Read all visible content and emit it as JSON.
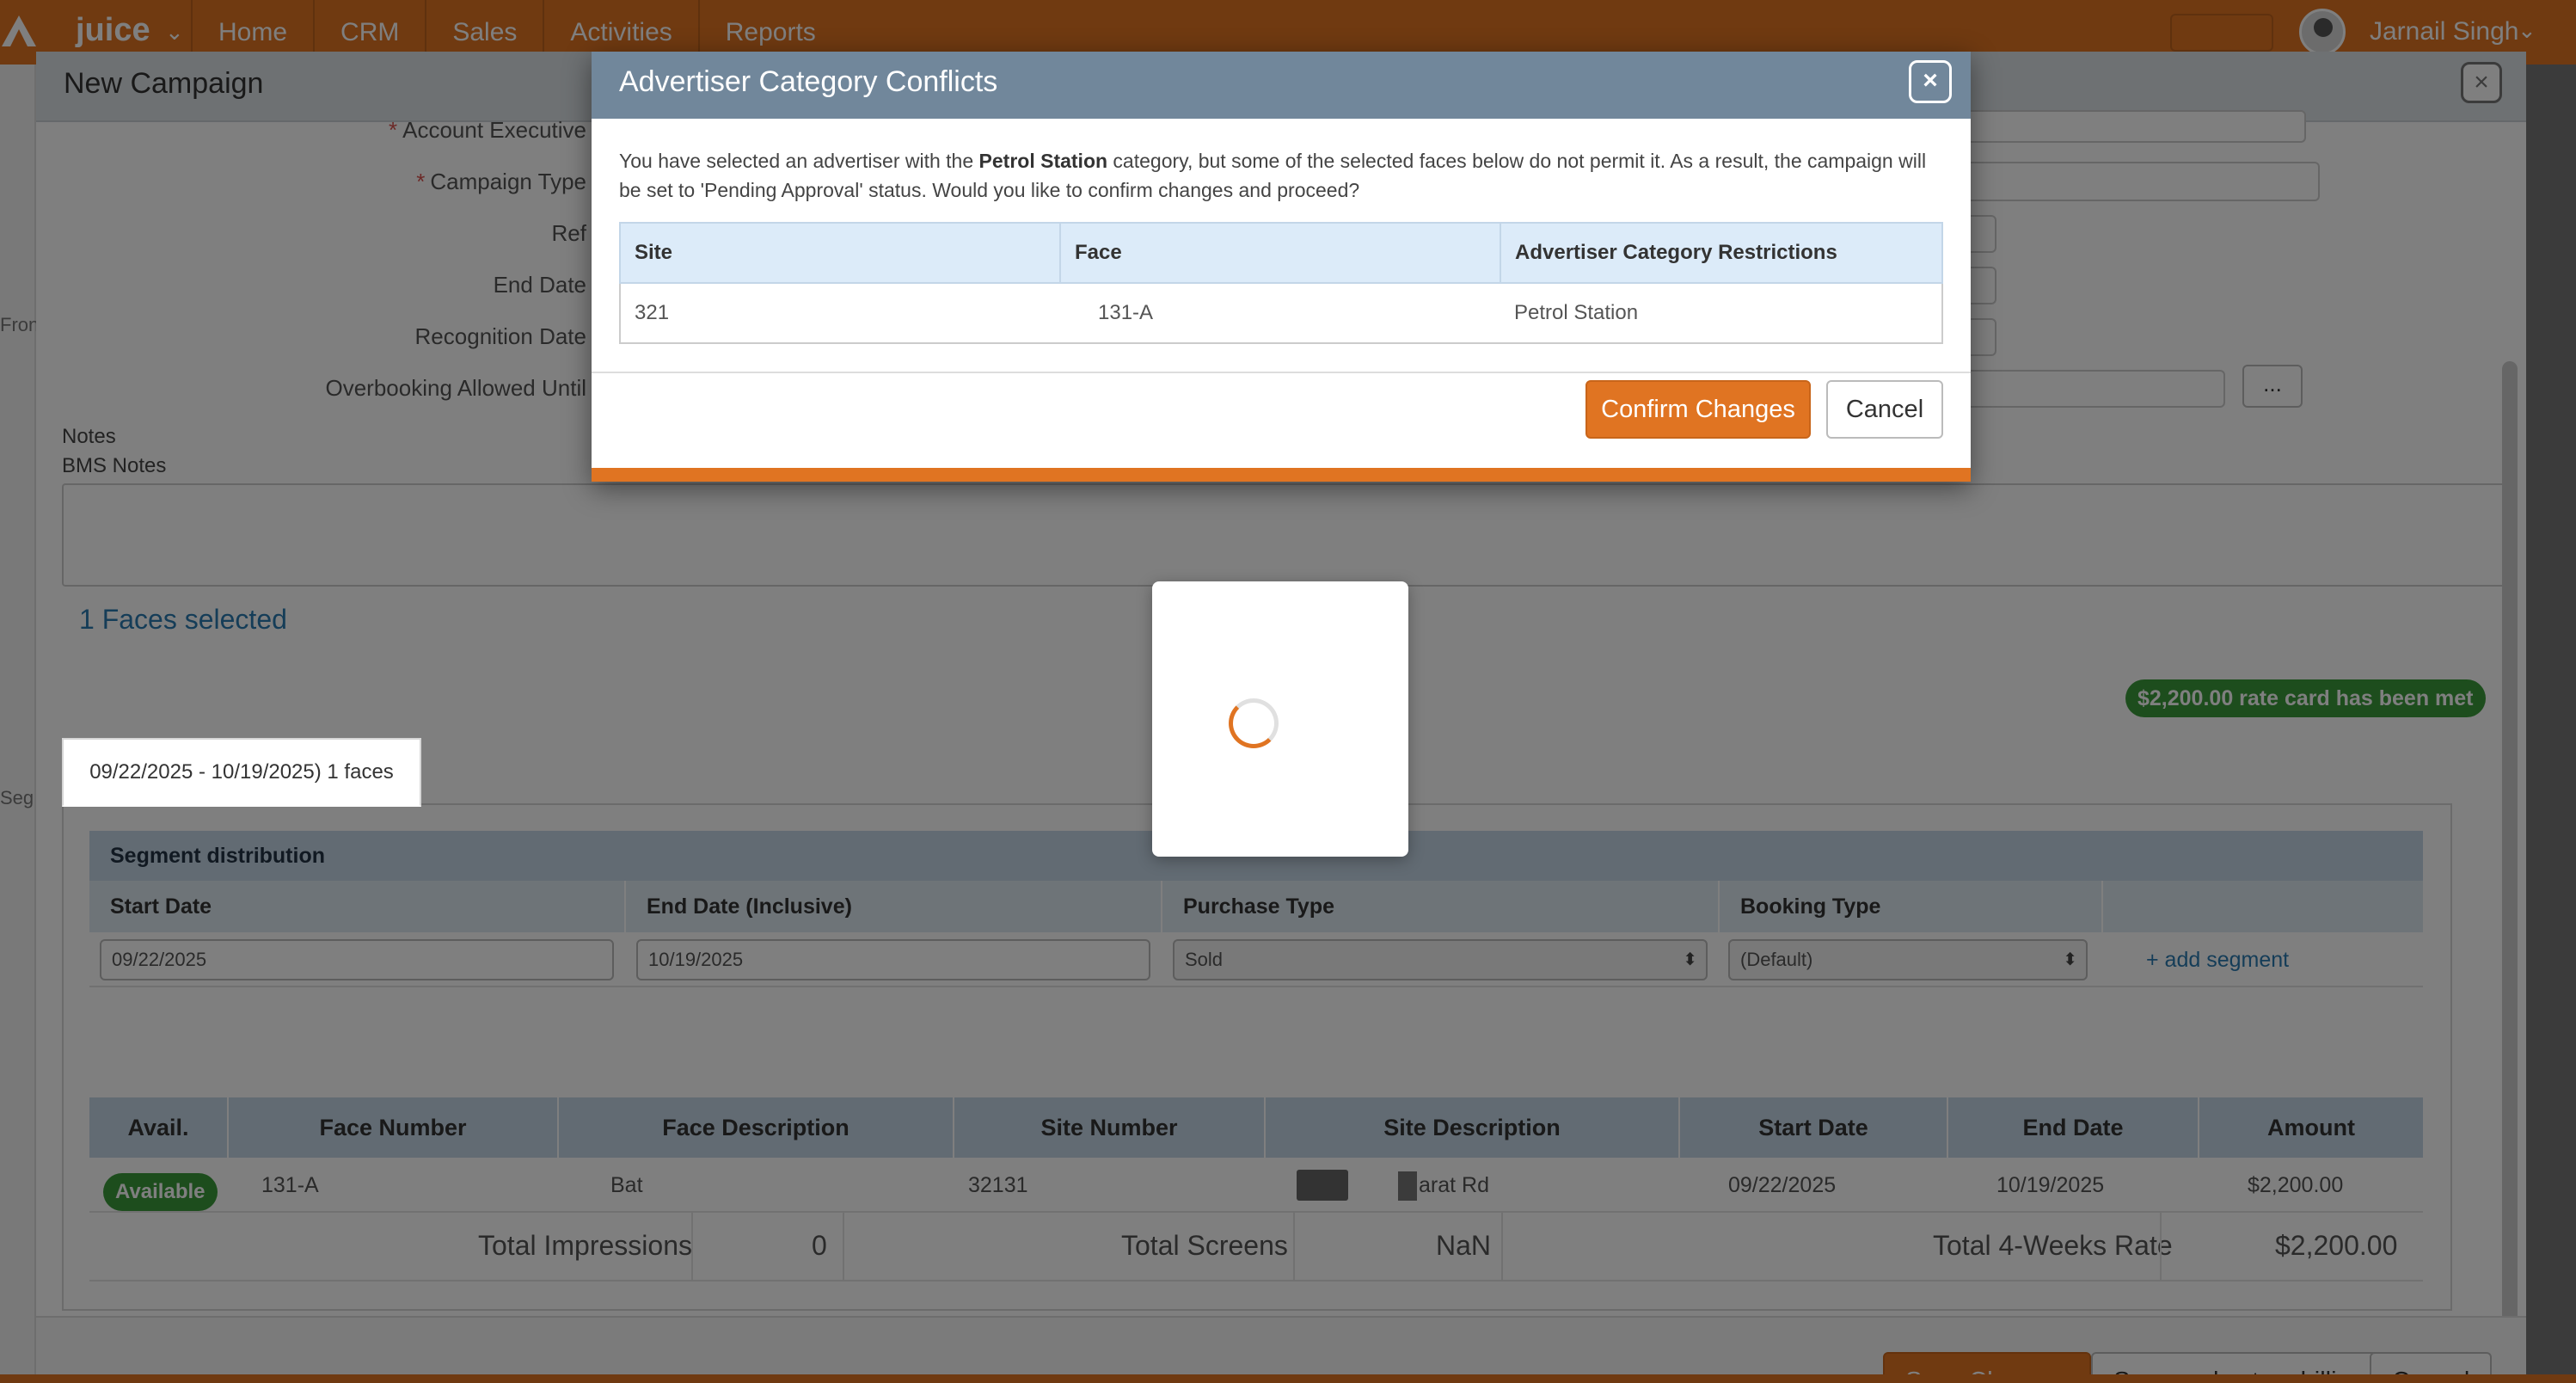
{
  "topbar": {
    "brand": "juice",
    "nav": [
      "Home",
      "CRM",
      "Sales",
      "Activities",
      "Reports"
    ],
    "user_name": "Jarnail Singh"
  },
  "left_strip": {
    "labels": [
      "Fron",
      "Seg"
    ]
  },
  "campaign": {
    "title": "New Campaign",
    "fields": {
      "account_executive": "Account Executive",
      "campaign_type": "Campaign Type",
      "ref": "Ref",
      "end_date": "End Date",
      "recognition_date": "Recognition Date",
      "overbooking": "Overbooking Allowed Until"
    },
    "overbooking_button": "...",
    "notes_label": "Notes",
    "bms_notes_label": "BMS Notes",
    "faces_selected": "1 Faces selected",
    "rate_badge": "$2,200.00 rate card has been met",
    "tab_label": "09/22/2025 - 10/19/2025) 1 faces",
    "segment": {
      "heading": "Segment distribution",
      "columns": [
        "Start Date",
        "End Date (Inclusive)",
        "Purchase Type",
        "Booking Type"
      ],
      "start_date": "09/22/2025",
      "end_date": "10/19/2025",
      "purchase_type": "Sold",
      "booking_type": "(Default)",
      "add_segment": "+ add segment"
    },
    "faces_table": {
      "columns": [
        "Avail.",
        "Face Number",
        "Face Description",
        "Site Number",
        "Site Description",
        "Start Date",
        "End Date",
        "Amount"
      ],
      "row": {
        "avail": "Available",
        "face_number": "131-A",
        "face_description": "Bat",
        "site_number": "32131",
        "site_description": "arat Rd",
        "start_date": "09/22/2025",
        "end_date": "10/19/2025",
        "amount": "$2,200.00"
      },
      "totals": {
        "impressions_label": "Total Impressions",
        "impressions_value": "0",
        "screens_label": "Total Screens",
        "screens_value": "NaN",
        "rate_label": "Total 4-Weeks Rate",
        "rate_value": "$2,200.00"
      }
    },
    "buttons": {
      "save_changes": "Save Changes",
      "save_billing": "Save and set up billing",
      "cancel": "Cancel"
    }
  },
  "dialog": {
    "title": "Advertiser Category Conflicts",
    "message_before": "You have selected an advertiser with the ",
    "message_category": "Petrol Station",
    "message_after": " category, but some of the selected faces below do not permit it. As a result, the campaign will be set to 'Pending Approval' status. Would you like to confirm changes and proceed?",
    "table": {
      "headers": [
        "Site",
        "Face",
        "Advertiser Category Restrictions"
      ],
      "rows": [
        [
          "321",
          "131-A",
          "Petrol Station"
        ]
      ]
    },
    "confirm_button": "Confirm Changes",
    "cancel_button": "Cancel"
  },
  "colors": {
    "brand_orange": "#e07422",
    "dialog_header": "#71879b",
    "available_green": "#3b9b3b",
    "link_blue": "#2a7ab0"
  }
}
